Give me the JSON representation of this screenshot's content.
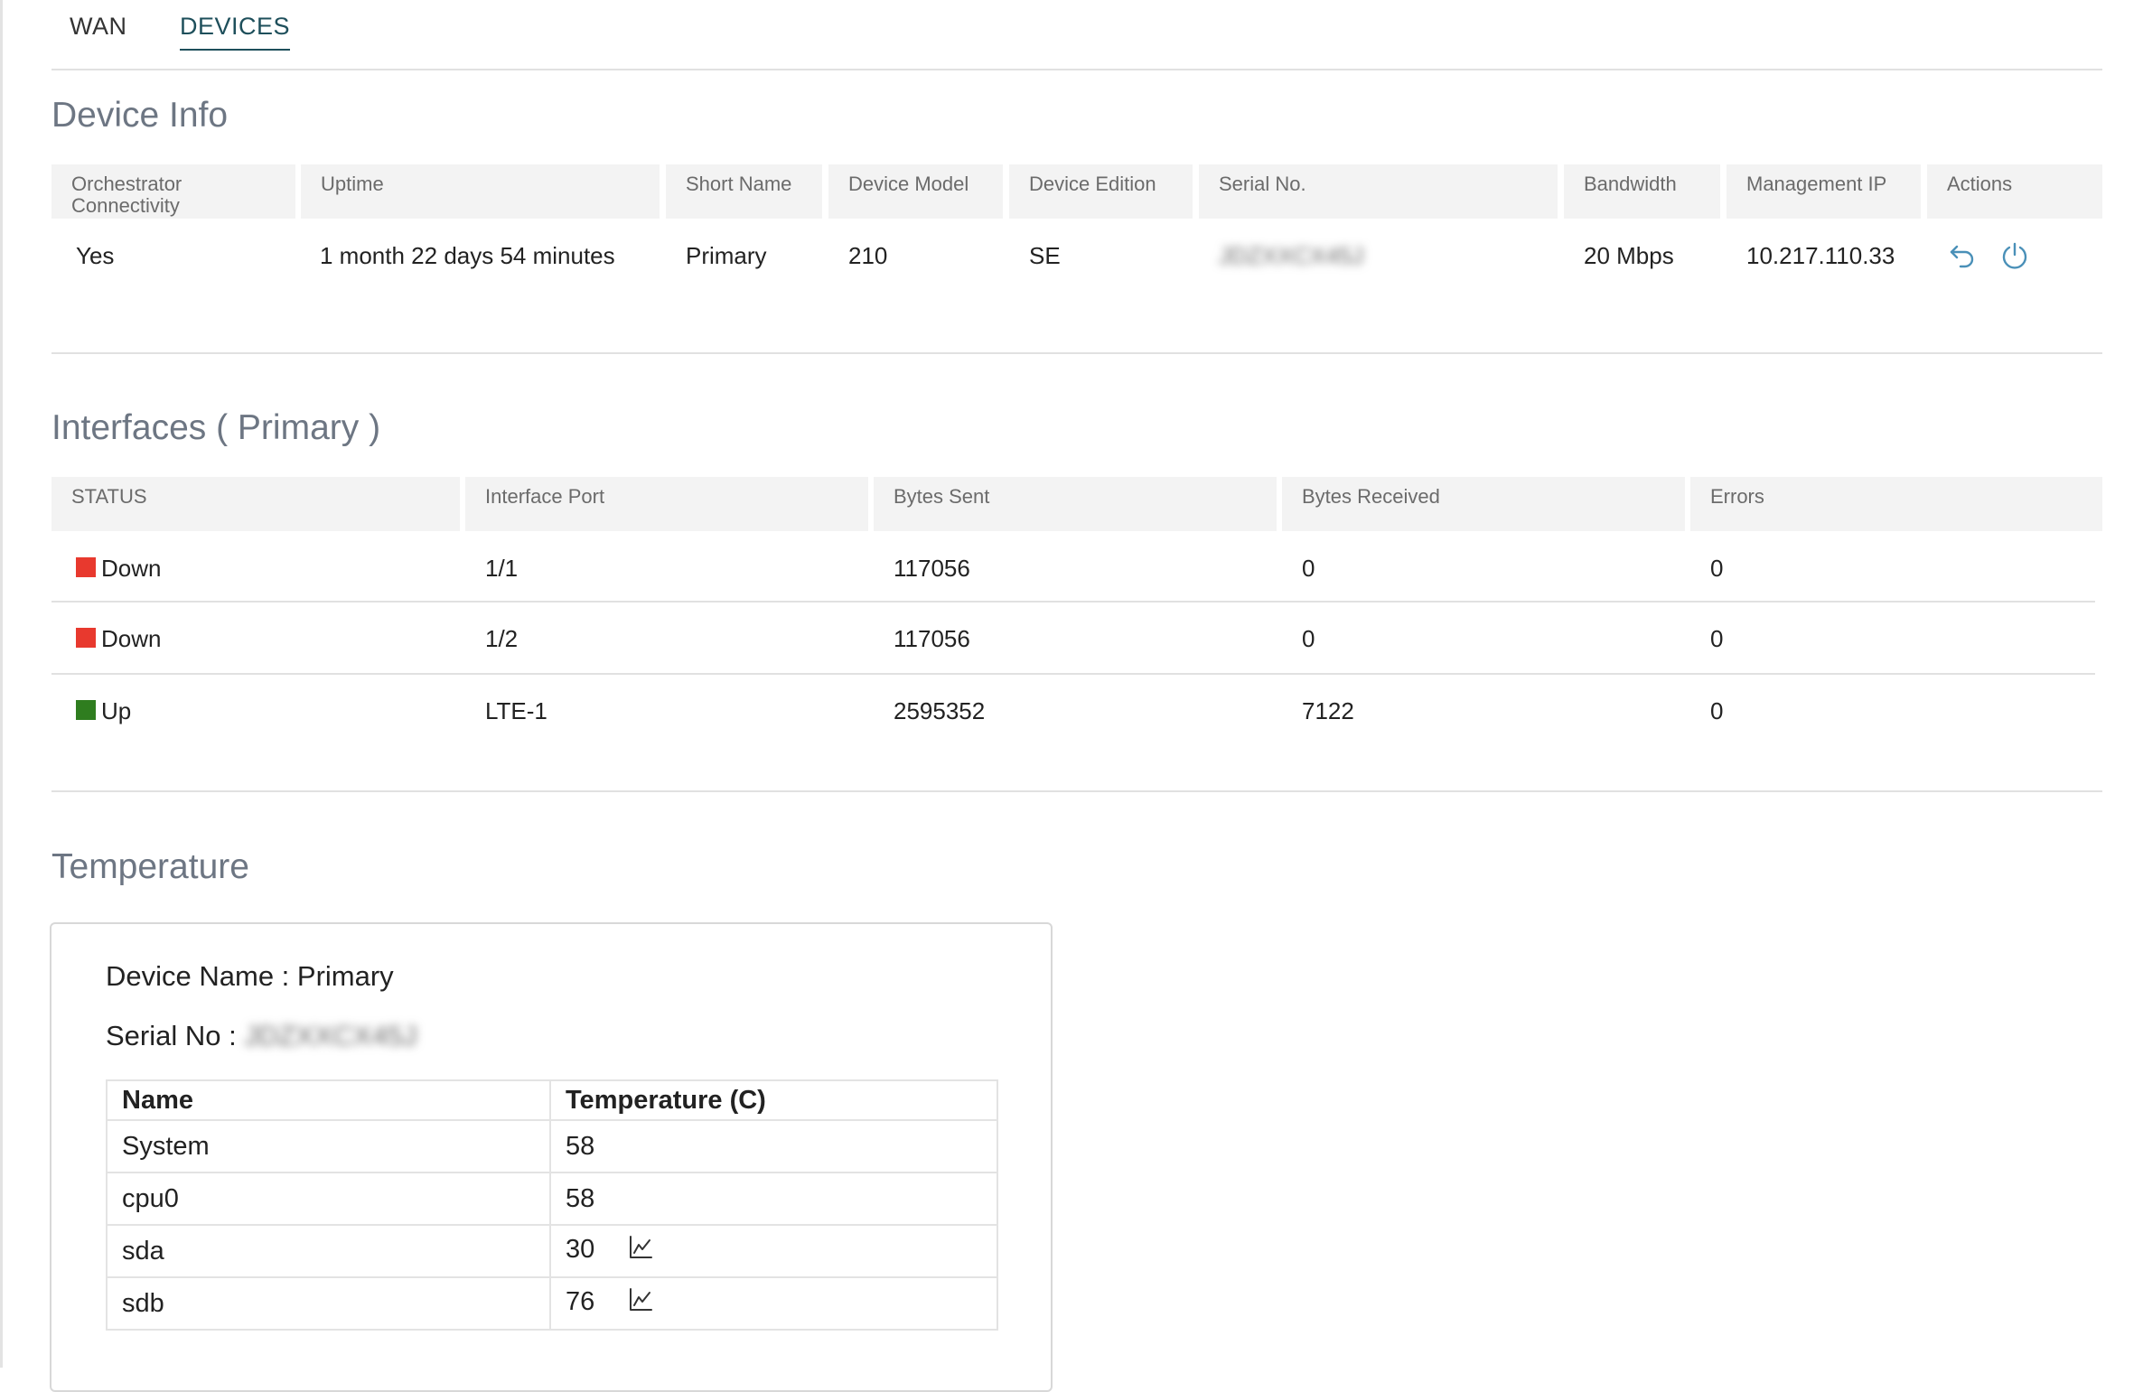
{
  "tabs": [
    {
      "label": "WAN"
    },
    {
      "label": "DEVICES"
    }
  ],
  "device_info": {
    "title": "Device Info",
    "headers": [
      "Orchestrator Connectivity",
      "Uptime",
      "Short Name",
      "Device Model",
      "Device Edition",
      "Serial No.",
      "Bandwidth",
      "Management IP",
      "Actions"
    ],
    "row": {
      "connectivity": "Yes",
      "uptime": "1 month 22 days 54 minutes",
      "short_name": "Primary",
      "model": "210",
      "edition": "SE",
      "serial": "JDZXXCX45J",
      "bandwidth": "20 Mbps",
      "management_ip": "10.217.110.33"
    },
    "actions": [
      "undo-icon",
      "power-icon"
    ]
  },
  "interfaces": {
    "title": "Interfaces ( Primary )",
    "headers": [
      "STATUS",
      "Interface Port",
      "Bytes Sent",
      "Bytes Received",
      "Errors"
    ],
    "rows": [
      {
        "status": "Down",
        "port": "1/1",
        "sent": "117056",
        "received": "0",
        "errors": "0"
      },
      {
        "status": "Down",
        "port": "1/2",
        "sent": "117056",
        "received": "0",
        "errors": "0"
      },
      {
        "status": "Up",
        "port": "LTE-1",
        "sent": "2595352",
        "received": "7122",
        "errors": "0"
      }
    ],
    "status_colors": {
      "Down": "#e8392e",
      "Up": "#2f7d1f"
    }
  },
  "temperature": {
    "title": "Temperature",
    "device_name_label": "Device Name : Primary",
    "serial_label": "Serial No :",
    "serial_value": "JDZXXCX45J",
    "headers": [
      "Name",
      "Temperature (C)"
    ],
    "rows": [
      {
        "name": "System",
        "value": "58",
        "chart": false
      },
      {
        "name": "cpu0",
        "value": "58",
        "chart": false
      },
      {
        "name": "sda",
        "value": "30",
        "chart": true
      },
      {
        "name": "sdb",
        "value": "76",
        "chart": true
      }
    ]
  },
  "colors": {
    "accent": "#1e4f5b",
    "icon": "#4a90b8",
    "title": "#6d7683"
  }
}
